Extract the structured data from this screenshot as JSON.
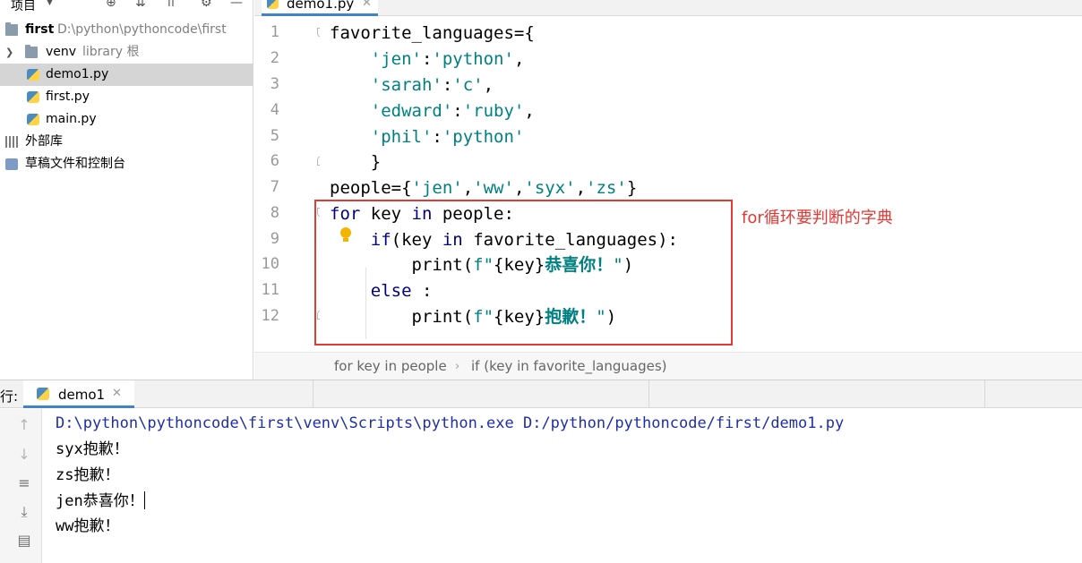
{
  "project": {
    "title": "项目",
    "items": [
      {
        "name": "first",
        "path": "D:\\python\\pythoncode\\first"
      },
      {
        "name": "venv",
        "extra": "library 根"
      },
      {
        "name": "demo1.py"
      },
      {
        "name": "first.py"
      },
      {
        "name": "main.py"
      },
      {
        "name": "外部库"
      },
      {
        "name": "草稿文件和控制台"
      }
    ]
  },
  "editor": {
    "tab": "demo1.py",
    "line_numbers": [
      "1",
      "2",
      "3",
      "4",
      "5",
      "6",
      "7",
      "8",
      "9",
      "10",
      "11",
      "12"
    ],
    "lines": [
      "favorite_languages={",
      "    'jen':'python',",
      "    'sarah':'c',",
      "    'edward':'ruby',",
      "    'phil':'python'",
      "    }",
      "people={'jen','ww','syx','zs'}",
      "for key in people:",
      "    if(key in favorite_languages):",
      "        print(f\"{key}恭喜你！\")",
      "    else :",
      "        print(f\"{key}抱歉！\")"
    ],
    "annotation": "for循环要判断的字典",
    "breadcrumb": [
      "for key in people",
      "if (key in favorite_languages)"
    ]
  },
  "run": {
    "label": "行:",
    "tab": "demo1",
    "output": [
      "D:\\python\\pythoncode\\first\\venv\\Scripts\\python.exe D:/python/pythoncode/first/demo1.py",
      "syx抱歉！",
      "zs抱歉！",
      "jen恭喜你！",
      "ww抱歉！"
    ]
  },
  "colors": {
    "keyword": "#000080",
    "string": "#008080",
    "annotation": "#e53935",
    "command": "#1f2fa6",
    "tab_accent": "#4083c9"
  }
}
